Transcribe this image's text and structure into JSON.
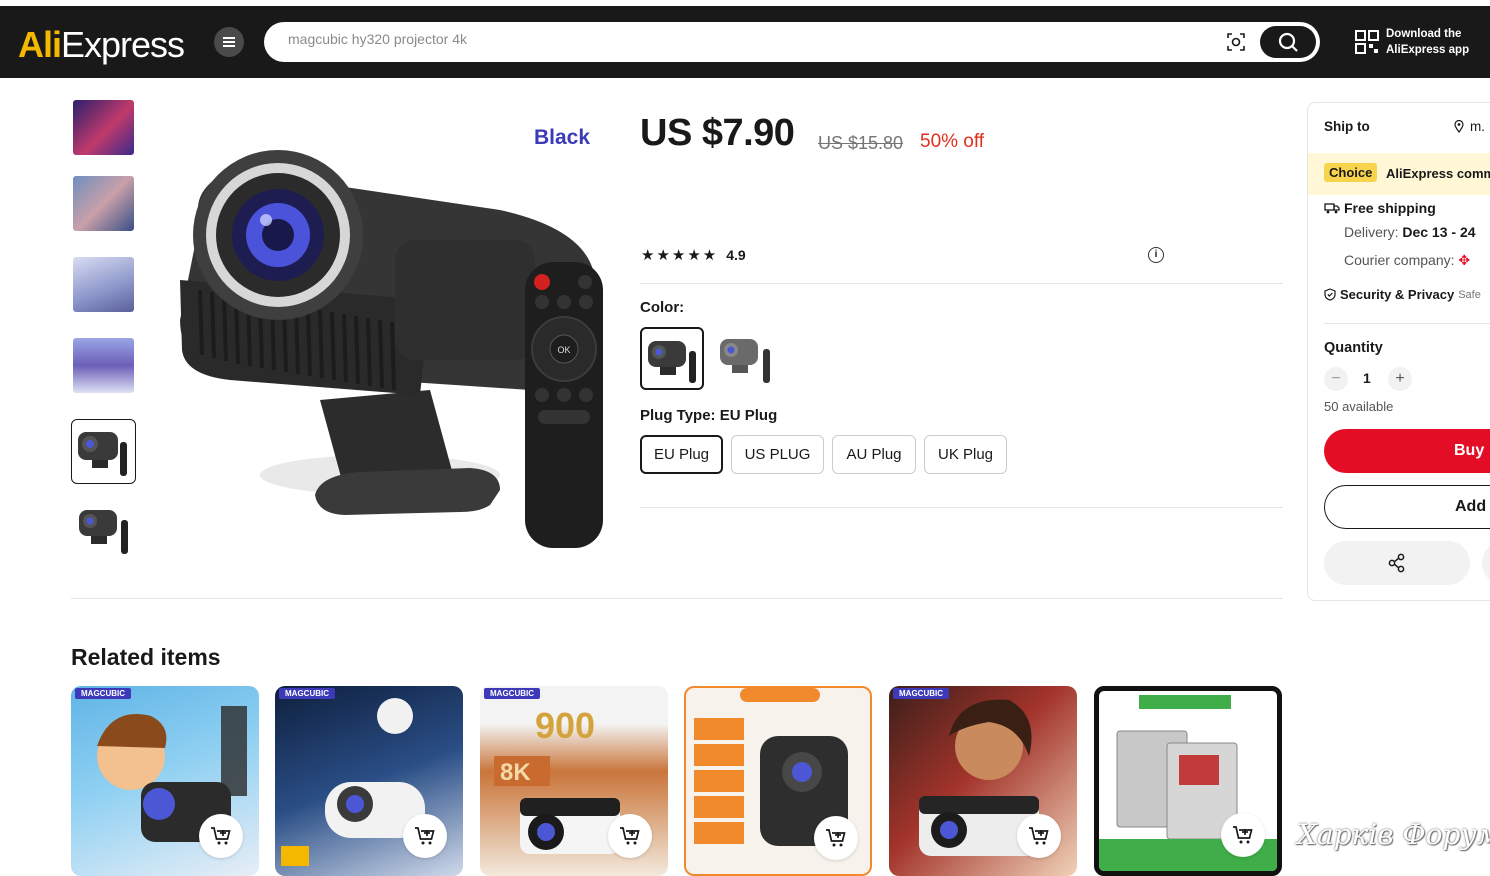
{
  "header": {
    "logo_ali": "Ali",
    "logo_express": "Express",
    "search_placeholder": "magcubic hy320 projector 4k",
    "download_line1": "Download the",
    "download_line2": "AliExpress app"
  },
  "gallery": {
    "variant_label": "Black"
  },
  "product": {
    "price": "US $7.90",
    "old_price": "US $15.80",
    "discount": "50% off",
    "stars": "★★★★★",
    "rating": "4.9",
    "color_label": "Color:",
    "plug_label": "Plug Type: EU Plug",
    "plugs": [
      "EU Plug",
      "US PLUG",
      "AU Plug",
      "UK Plug"
    ]
  },
  "panel": {
    "ship_to": "Ship to",
    "ship_loc": "m.",
    "choice_badge": "Choice",
    "choice_text": "AliExpress comm",
    "free_shipping": "Free shipping",
    "delivery_label": "Delivery: ",
    "delivery_dates": "Dec 13 - 24",
    "courier_label": "Courier company:",
    "security": "Security & Privacy",
    "security_safe": "Safe",
    "quantity_label": "Quantity",
    "quantity": "1",
    "available": "50 available",
    "buy_label": "Buy",
    "add_label": "Add"
  },
  "related": {
    "title": "Related items",
    "brand": "MAGCUBIC"
  },
  "watermark": "Харків Форум",
  "colors": {
    "accent_red": "#e30e26",
    "discount_red": "#e0301e",
    "header_bg": "#191919",
    "choice_yellow": "#f7d44c",
    "variant_blue": "#3b3bb8"
  }
}
